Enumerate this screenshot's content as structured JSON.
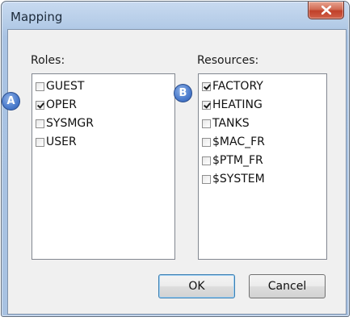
{
  "dialog": {
    "title": "Mapping",
    "ok_label": "OK",
    "cancel_label": "Cancel"
  },
  "roles": {
    "label": "Roles:",
    "marker": "A",
    "items": [
      {
        "label": "GUEST",
        "checked": false
      },
      {
        "label": "OPER",
        "checked": true
      },
      {
        "label": "SYSMGR",
        "checked": false
      },
      {
        "label": "USER",
        "checked": false
      }
    ]
  },
  "resources": {
    "label": "Resources:",
    "marker": "B",
    "items": [
      {
        "label": "FACTORY",
        "checked": true
      },
      {
        "label": "HEATING",
        "checked": true
      },
      {
        "label": "TANKS",
        "checked": false
      },
      {
        "label": "$MAC_FR",
        "checked": false
      },
      {
        "label": "$PTM_FR",
        "checked": false
      },
      {
        "label": "$SYSTEM",
        "checked": false
      }
    ]
  }
}
